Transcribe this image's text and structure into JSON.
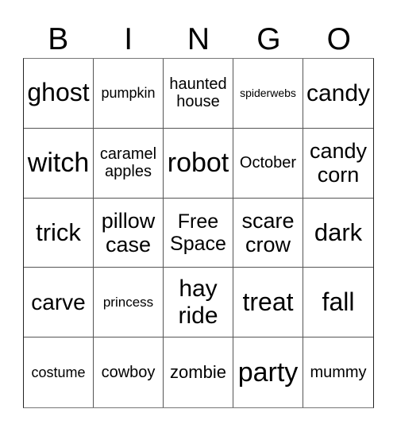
{
  "header": [
    "B",
    "I",
    "N",
    "G",
    "O"
  ],
  "cells": [
    {
      "text": "ghost",
      "size": 32
    },
    {
      "text": "pumpkin",
      "size": 18
    },
    {
      "text": "haunted\nhouse",
      "size": 20
    },
    {
      "text": "spiderwebs",
      "size": 14
    },
    {
      "text": "candy",
      "size": 30
    },
    {
      "text": "witch",
      "size": 34
    },
    {
      "text": "caramel\napples",
      "size": 20
    },
    {
      "text": "robot",
      "size": 34
    },
    {
      "text": "October",
      "size": 20
    },
    {
      "text": "candy\ncorn",
      "size": 27
    },
    {
      "text": "trick",
      "size": 31
    },
    {
      "text": "pillow\ncase",
      "size": 27
    },
    {
      "text": "Free\nSpace",
      "size": 25
    },
    {
      "text": "scare\ncrow",
      "size": 27
    },
    {
      "text": "dark",
      "size": 31
    },
    {
      "text": "carve",
      "size": 28
    },
    {
      "text": "princess",
      "size": 17
    },
    {
      "text": "hay\nride",
      "size": 30
    },
    {
      "text": "treat",
      "size": 32
    },
    {
      "text": "fall",
      "size": 32
    },
    {
      "text": "costume",
      "size": 18
    },
    {
      "text": "cowboy",
      "size": 20
    },
    {
      "text": "zombie",
      "size": 22
    },
    {
      "text": "party",
      "size": 34
    },
    {
      "text": "mummy",
      "size": 20
    }
  ]
}
